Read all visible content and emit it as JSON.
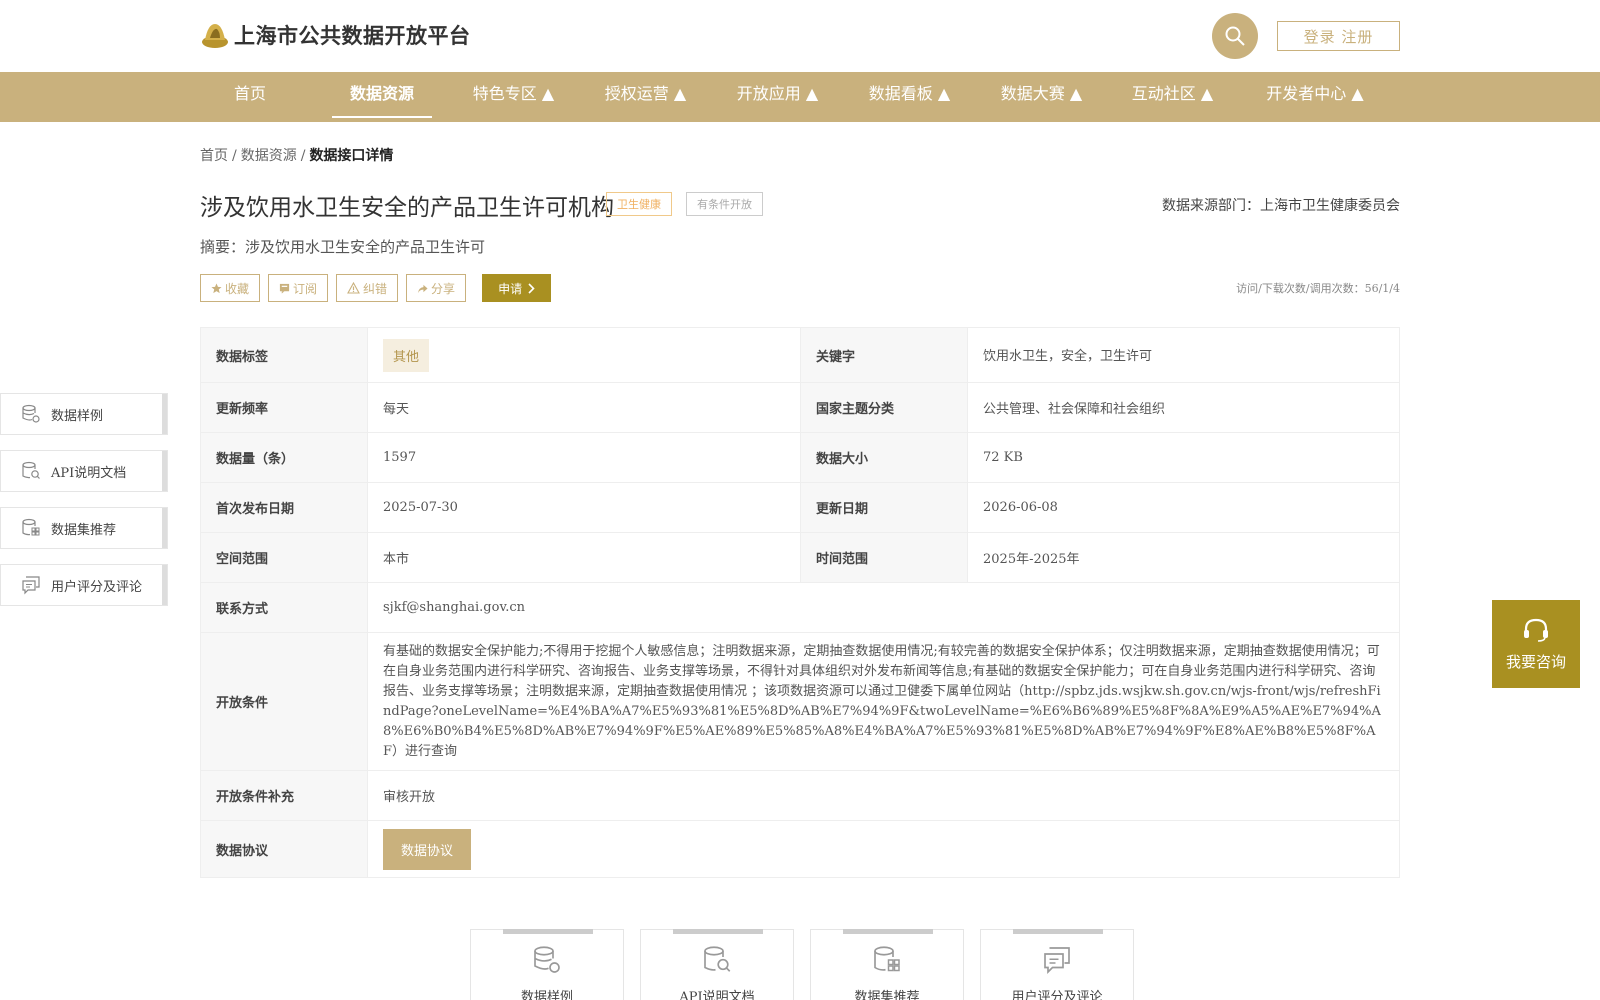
{
  "header": {
    "site_title": "上海市公共数据开放平台",
    "login_label": "登录 注册"
  },
  "nav": {
    "items": [
      {
        "label": "首页"
      },
      {
        "label": "数据资源"
      },
      {
        "label": "特色专区 ▲"
      },
      {
        "label": "授权运营 ▲"
      },
      {
        "label": "开放应用 ▲"
      },
      {
        "label": "数据看板 ▲"
      },
      {
        "label": "数据大赛 ▲"
      },
      {
        "label": "互动社区 ▲"
      },
      {
        "label": "开发者中心 ▲"
      }
    ]
  },
  "breadcrumb": {
    "home": "首页",
    "sep": "/",
    "resources": "数据资源",
    "current": "数据接口详情"
  },
  "detail": {
    "title": "涉及饮用水卫生安全的产品卫生许可机构",
    "tag_domain": "卫生健康",
    "tag_open": "有条件开放",
    "source": "数据来源部门：上海市卫生健康委员会",
    "summary": "摘要：涉及饮用水卫生安全的产品卫生许可",
    "stats": "访问/下载次数/调用次数：56/1/4"
  },
  "actions": {
    "favorite": "收藏",
    "subscribe": "订阅",
    "report": "纠错",
    "share": "分享",
    "apply": "申请"
  },
  "table": {
    "tags_label": "数据标签",
    "tags_value": "其他",
    "keywords_label": "关键字",
    "keywords_value": "饮用水卫生，安全，卫生许可",
    "freq_label": "更新频率",
    "freq_value": "每天",
    "theme_label": "国家主题分类",
    "theme_value": "公共管理、社会保障和社会组织",
    "count_label": "数据量（条）",
    "count_value": "1597",
    "size_label": "数据大小",
    "size_value": "72 KB",
    "first_label": "首次发布日期",
    "first_value": "2025-07-30",
    "update_label": "更新日期",
    "update_value": "2026-06-08",
    "space_label": "空间范围",
    "space_value": "本市",
    "time_label": "时间范围",
    "time_value": "2025年-2025年",
    "contact_label": "联系方式",
    "contact_value": "sjkf@shanghai.gov.cn",
    "cond_label": "开放条件",
    "cond_value": "有基础的数据安全保护能力;不得用于挖掘个人敏感信息；注明数据来源，定期抽查数据使用情况;有较完善的数据安全保护体系；仅注明数据来源，定期抽查数据使用情况；可在自身业务范围内进行科学研究、咨询报告、业务支撑等场景，不得针对具体组织对外发布新闻等信息;有基础的数据安全保护能力；可在自身业务范围内进行科学研究、咨询报告、业务支撑等场景；注明数据来源，定期抽查数据使用情况 ；该项数据资源可以通过卫健委下属单位网站（http://spbz.jds.wsjkw.sh.gov.cn/wjs-front/wjs/refreshFindPage?oneLevelName=%E4%BA%A7%E5%93%81%E5%8D%AB%E7%94%9F&twoLevelName=%E6%B6%89%E5%8F%8A%E9%A5%AE%E7%94%A8%E6%B0%B4%E5%8D%AB%E7%94%9F%E5%AE%89%E5%85%A8%E4%BA%A7%E5%93%81%E5%8D%AB%E7%94%9F%E8%AE%B8%E5%8F%AF）进行查询",
    "cond_extra_label": "开放条件补充",
    "cond_extra_value": "审核开放",
    "agreement_label": "数据协议",
    "agreement_button": "数据协议"
  },
  "sidenav": {
    "items": [
      {
        "label": "数据样例",
        "icon": "database-gear-icon"
      },
      {
        "label": "API说明文档",
        "icon": "doc-search-icon"
      },
      {
        "label": "数据集推荐",
        "icon": "database-grid-icon"
      },
      {
        "label": "用户评分及评论",
        "icon": "comment-icon"
      }
    ]
  },
  "consult": {
    "label": "我要咨询"
  },
  "cards": {
    "items": [
      {
        "label": "数据样例"
      },
      {
        "label": "API说明文档"
      },
      {
        "label": "数据集推荐"
      },
      {
        "label": "用户评分及评论"
      }
    ]
  },
  "colors": {
    "brand": "#c9b17d",
    "accent_dark": "#a99021"
  }
}
